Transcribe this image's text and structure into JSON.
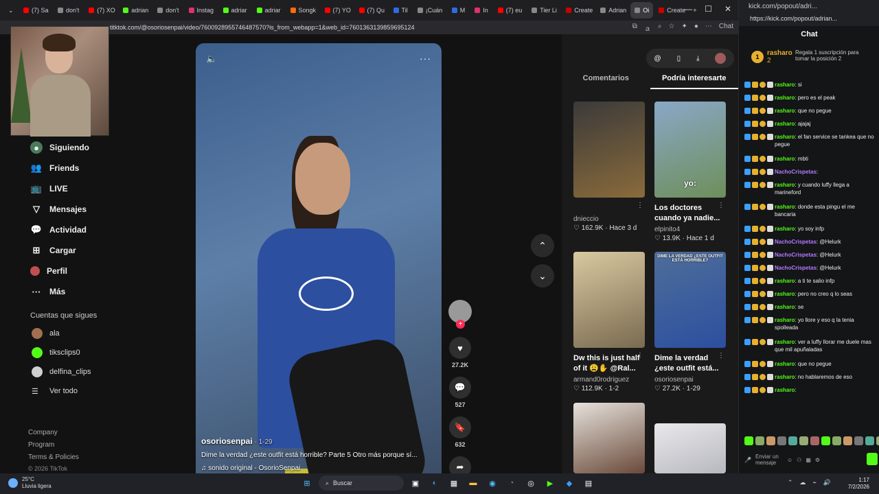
{
  "browser": {
    "tabs": [
      {
        "label": "(7) Sa",
        "color": "#ff0000"
      },
      {
        "label": "don't",
        "color": "#888"
      },
      {
        "label": "(7) XO",
        "color": "#ff0000"
      },
      {
        "label": "adrian",
        "color": "#53fc18"
      },
      {
        "label": "don't",
        "color": "#888"
      },
      {
        "label": "Instag",
        "color": "#e1306c"
      },
      {
        "label": "adriar",
        "color": "#53fc18"
      },
      {
        "label": "adriar",
        "color": "#53fc18"
      },
      {
        "label": "Songk",
        "color": "#ff6b00"
      },
      {
        "label": "(7) YO",
        "color": "#ff0000"
      },
      {
        "label": "(7) Qu",
        "color": "#ff0000"
      },
      {
        "label": "Til",
        "color": "#2d6cdf"
      },
      {
        "label": "¡Cuán",
        "color": "#888"
      },
      {
        "label": "M",
        "color": "#2d6cdf"
      },
      {
        "label": "In",
        "color": "#e1306c"
      },
      {
        "label": "(7) eu",
        "color": "#ff0000"
      },
      {
        "label": "Tier Li",
        "color": "#888"
      },
      {
        "label": "Create",
        "color": "#c00"
      },
      {
        "label": "Adrian",
        "color": "#888"
      },
      {
        "label": "Oi",
        "color": "#888"
      },
      {
        "label": "Create",
        "color": "#c00"
      }
    ],
    "url": "titktok.com/@osoriosenpai/video/7600928955746487570?is_from_webapp=1&web_id=7601363139859695124",
    "chat_label": "Chat"
  },
  "sidebar": {
    "nav": [
      {
        "label": "Siguiendo",
        "icon": "following-icon",
        "glyph": "●"
      },
      {
        "label": "Friends",
        "icon": "friends-icon",
        "glyph": "👥"
      },
      {
        "label": "LIVE",
        "icon": "live-icon",
        "glyph": "📺"
      },
      {
        "label": "Mensajes",
        "icon": "inbox-icon",
        "glyph": "▽"
      },
      {
        "label": "Actividad",
        "icon": "activity-icon",
        "glyph": "💬"
      },
      {
        "label": "Cargar",
        "icon": "upload-icon",
        "glyph": "⊞"
      },
      {
        "label": "Perfil",
        "icon": "profile-icon",
        "glyph": "●"
      },
      {
        "label": "Más",
        "icon": "more-icon",
        "glyph": "···"
      }
    ],
    "following_heading": "Cuentas que sigues",
    "following": [
      {
        "name": "ala",
        "color": "#a07050"
      },
      {
        "name": "tiksclips0",
        "color": "#53fc18"
      },
      {
        "name": "delfina_clips",
        "color": "#cfcfcf"
      }
    ],
    "see_all": "Ver todo",
    "footer": [
      "Company",
      "Program",
      "Terms & Policies"
    ],
    "copyright": "© 2026 TikTok"
  },
  "video": {
    "author": "osoriosenpai",
    "date": " · 1-29",
    "description": "Dime la verdad ¿este outfit está horrible? Parte 5 Otro más porque sí...",
    "sound": "sonido original - OsorioSenpai"
  },
  "actions": {
    "likes": "27.2K",
    "comments": "527",
    "saves": "632"
  },
  "recommendations": {
    "tabs": [
      "Comentarios",
      "Podría interesarte"
    ],
    "active_tab": 1,
    "cards": [
      {
        "title": "",
        "author": "dnieccio",
        "stats": "♡ 162.9K · Hace 3 d",
        "colors": [
          "#3b3a3a",
          "#8a6b3b"
        ]
      },
      {
        "title": "Los doctores cuando ya nadie...",
        "author": "elpinito4",
        "stats": "♡ 13.9K · Hace 1 d",
        "colors": [
          "#8aa7c7",
          "#6d8f5a"
        ],
        "overlay": "yo:"
      },
      {
        "title": "Dw this is just half of it 😩✋ @Ral...",
        "author": "armand0rodriguez",
        "stats": "♡ 112.9K · 1-2",
        "colors": [
          "#d9c9a0",
          "#7a6a50"
        ]
      },
      {
        "title": "Dime la verdad ¿este outfit está...",
        "author": "osoriosenpai",
        "stats": "♡ 27.2K · 1-29",
        "colors": [
          "#4e6e99",
          "#2c4fa0"
        ],
        "overlay": "DIME LA VERDAD ¿ESTE OUTFIT ESTÁ HORRIBLE?"
      },
      {
        "title": "",
        "author": "",
        "stats": "",
        "colors": [
          "#e6e2dc",
          "#6a4a3a"
        ]
      },
      {
        "title": "",
        "author": "",
        "stats": "",
        "colors": [
          "#e9e9ec",
          "#b7b7bf"
        ]
      }
    ]
  },
  "kick": {
    "window_title": "kick.com/popout/adri...",
    "url": "https://kick.com/popout/adrian...",
    "title": "Chat",
    "pinned_user": "rasharo",
    "pinned_count": "2",
    "pinned_gift": "Regala 1 suscripción para tomar la posición 2",
    "messages": [
      {
        "user": "rasharo",
        "text": "si",
        "color": "#53fc18"
      },
      {
        "user": "rasharo",
        "text": "pero es el peak",
        "color": "#53fc18"
      },
      {
        "user": "rasharo",
        "text": "que no pegue",
        "color": "#53fc18"
      },
      {
        "user": "rasharo",
        "text": "ajajaj",
        "color": "#53fc18"
      },
      {
        "user": "rasharo",
        "text": "el fan service se tankea que no pegue",
        "color": "#53fc18"
      },
      {
        "user": "rasharo",
        "text": "mbti",
        "color": "#53fc18"
      },
      {
        "user": "NachoCrispetas",
        "text": "",
        "color": "#b37bff"
      },
      {
        "user": "rasharo",
        "text": "y cuando luffy llega a marineford",
        "color": "#53fc18"
      },
      {
        "user": "rasharo",
        "text": "donde esta pingu el me bancaria",
        "color": "#53fc18"
      },
      {
        "user": "rasharo",
        "text": "yo soy infp",
        "color": "#53fc18"
      },
      {
        "user": "NachoCrispetas",
        "text": "@Helurk",
        "color": "#b37bff"
      },
      {
        "user": "NachoCrispetas",
        "text": "@Helurk",
        "color": "#b37bff"
      },
      {
        "user": "NachoCrispetas",
        "text": "@Helurk",
        "color": "#b37bff"
      },
      {
        "user": "rasharo",
        "text": "a ti te salio infp",
        "color": "#53fc18"
      },
      {
        "user": "rasharo",
        "text": "pero no creo q lo seas",
        "color": "#53fc18"
      },
      {
        "user": "rasharo",
        "text": "se",
        "color": "#53fc18"
      },
      {
        "user": "rasharo",
        "text": "yo llore y eso q la tenia spolleada",
        "color": "#53fc18"
      },
      {
        "user": "rasharo",
        "text": "ver a luffy llorar me duele mas que mil apuñaladas",
        "color": "#53fc18"
      },
      {
        "user": "rasharo",
        "text": "que no pegue",
        "color": "#53fc18"
      },
      {
        "user": "rasharo",
        "text": "no hablaremos de eso",
        "color": "#53fc18"
      },
      {
        "user": "rasharo",
        "text": "",
        "color": "#53fc18"
      }
    ],
    "input_placeholder": "Enviar un mensaje"
  },
  "taskbar": {
    "temp": "25°C",
    "weather": "Lluvia ligera",
    "search": "Buscar",
    "time": "1:17",
    "date": "7/2/2026"
  }
}
